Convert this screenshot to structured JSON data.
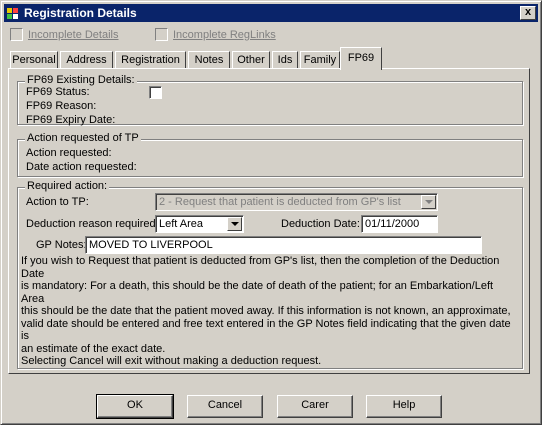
{
  "window": {
    "title": "Registration Details",
    "close_label": "x"
  },
  "top_checks": [
    {
      "label": "Incomplete Details"
    },
    {
      "label": "Incomplete RegLinks"
    }
  ],
  "tabs": [
    {
      "label": "Personal"
    },
    {
      "label": "Address"
    },
    {
      "label": "Registration"
    },
    {
      "label": "Notes"
    },
    {
      "label": "Other"
    },
    {
      "label": "Ids"
    },
    {
      "label": "Family"
    },
    {
      "label": "FP69"
    }
  ],
  "fp69_existing": {
    "legend": "FP69 Existing Details:",
    "status_label": "FP69 Status:",
    "reason_label": "FP69 Reason:",
    "expiry_label": "FP69 Expiry Date:"
  },
  "action_requested": {
    "legend": "Action requested of TP",
    "action_label": "Action requested:",
    "date_label": "Date action requested:"
  },
  "required_action": {
    "legend": "Required action:",
    "action_to_tp_label": "Action to TP:",
    "action_to_tp_value": "2 - Request that patient is deducted from GP's list",
    "deduction_reason_label": "Deduction reason required:",
    "deduction_reason_value": "Left Area",
    "deduction_date_label": "Deduction Date:",
    "deduction_date_value": "01/11/2000",
    "gp_notes_label": "GP Notes:",
    "gp_notes_value": "MOVED TO LIVERPOOL",
    "help_lines": [
      "If you wish to Request that patient is deducted from GP's list, then the completion of the Deduction Date",
      "is mandatory: For a death, this should be the date of death of the patient; for an Embarkation/Left Area",
      "this should be the date that the patient moved away. If this information is not known, an approximate,",
      "valid date should be entered and free text entered in the GP Notes field indicating that the given date is",
      "an estimate of the exact date.",
      "Selecting Cancel will exit without making a deduction request."
    ]
  },
  "buttons": {
    "ok": "OK",
    "cancel": "Cancel",
    "carer": "Carer",
    "help": "Help"
  }
}
